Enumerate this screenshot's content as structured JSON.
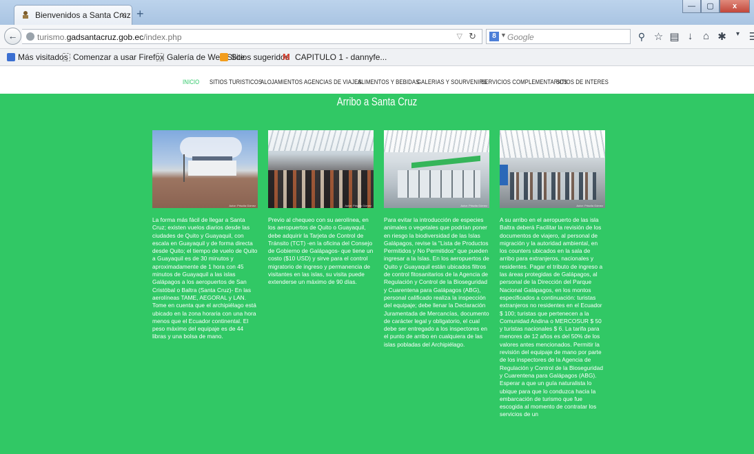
{
  "browser": {
    "tab_title": "Bienvenidos a Santa Cruz",
    "tab_close": "×",
    "new_tab": "+",
    "window_buttons": [
      "—",
      "▢",
      "x"
    ],
    "url_host_prefix": "turismo.",
    "url_host_main": "gadsantacruz.gob.ec",
    "url_path": "/index.php",
    "search_engine": "8",
    "search_placeholder": "Google",
    "toolbar_icons": [
      "star-icon",
      "reading-list-icon",
      "download-icon",
      "home-icon",
      "puzzle-icon",
      "dropdown-icon",
      "menu-icon"
    ]
  },
  "bookmarks": [
    {
      "label": "Más visitados",
      "icon": "blue"
    },
    {
      "label": "Comenzar a usar Firefox",
      "icon": "dashed"
    },
    {
      "label": "Galería de Web Slice",
      "icon": "dashed"
    },
    {
      "label": "Sitios sugeridos",
      "icon": "orange"
    },
    {
      "label": "CAPITULO 1 - dannyfe...",
      "icon": "gmail"
    }
  ],
  "site_nav": [
    "INICIO",
    "SITIOS TURISTICOS",
    "ALOJAMIENTOS",
    "AGENCIAS DE VIAJES",
    "ALIMENTOS Y BEBIDAS",
    "GALERIAS Y SOURVENIRS",
    "SERVICIOS COMPLEMENTARIOS",
    "SITIOS DE INTERES"
  ],
  "hero": {
    "heading": "Arribo a Santa Cruz",
    "accent_color": "#31c865"
  },
  "cards": [
    {
      "photo_caption": "Autor: Priscila Gómez",
      "text": "La forma más fácil de llegar a Santa Cruz; existen vuelos diarios desde las ciudades de Quito y Guayaquil, con escala en Guayaquil y de forma directa desde Quito; el tiempo de vuelo de Quito a Guayaquil es de 30 minutos y aproximadamente de 1 hora con 45 minutos de Guayaquil a las islas Galápagos a los aeropuertos de San Cristóbal o Baltra (Santa Cruz)- En las aerolíneas TAME, AEGORAL y LAN. Tome en cuenta que el archipiélago está ubicado en la zona horaria con una hora menos que el Ecuador continental. El peso máximo del equipaje es de 44 libras y una bolsa de mano."
    },
    {
      "photo_caption": "Autor: Priscila Gómez",
      "text": "Previo al chequeo con su aerolínea, en los aeropuertos de Quito o Guayaquil, debe adquirir la Tarjeta de Control de Tránsito (TCT) -en la oficina del Consejo de Gobierno de Galápagos- que tiene un costo ($10 USD) y sirve para el control migratorio de ingreso y permanencia de visitantes en las islas, su visita puede extenderse un máximo de 90 días."
    },
    {
      "photo_caption": "Autor: Priscila Gómez",
      "text": "Para evitar la introducción de especies animales o vegetales que podrían poner en riesgo la biodiversidad de las Islas Galápagos, revise la \"Lista de Productos Permitidos y No Permitidos\" que pueden ingresar a la Islas. En los aeropuertos de Quito y Guayaquil están ubicados filtros de control fitosanitarios de la Agencia de Regulación y Control de la Bioseguridad y Cuarentena para Galápagos (ABG), personal calificado realiza la inspección del equipaje; debe llenar la Declaración Juramentada de Mercancías, documento de carácter legal y obligatorio, el cual debe ser entregado a los inspectores en el punto de arribo en cualquiera de las islas pobladas del Archipiélago."
    },
    {
      "photo_caption": "Autor: Priscila Gómez",
      "text": "A su arribo en el aeropuerto de las isla Baltra deberá Facilitar la revisión de los documentos de viajero, al personal de migración y la autoridad ambiental, en los counters ubicados en la sala de arribo para extranjeros, nacionales y residentes. Pagar el tributo de ingreso a las áreas protegidas de Galápagos, al personal de la Dirección del Parque Nacional Galápagos, en los montos especificados a continuación: turistas extranjeros no residentes en el Ecuador $ 100; turistas que pertenecen a la Comunidad Andina o MERCOSUR $ 50 y turistas nacionales $ 6. La tarifa para menores de 12 años es del 50% de los valores antes mencionados. Permitir la revisión del equipaje de mano por parte de los inspectores de la Agencia de Regulación y Control de la Bioseguridad y Cuarentena para Galápagos (ABG). Esperar a que un guía naturalista lo ubique para que lo conduzca hacia la embarcación de turismo que fue escogida al momento de contratar los servicios de un"
    }
  ]
}
